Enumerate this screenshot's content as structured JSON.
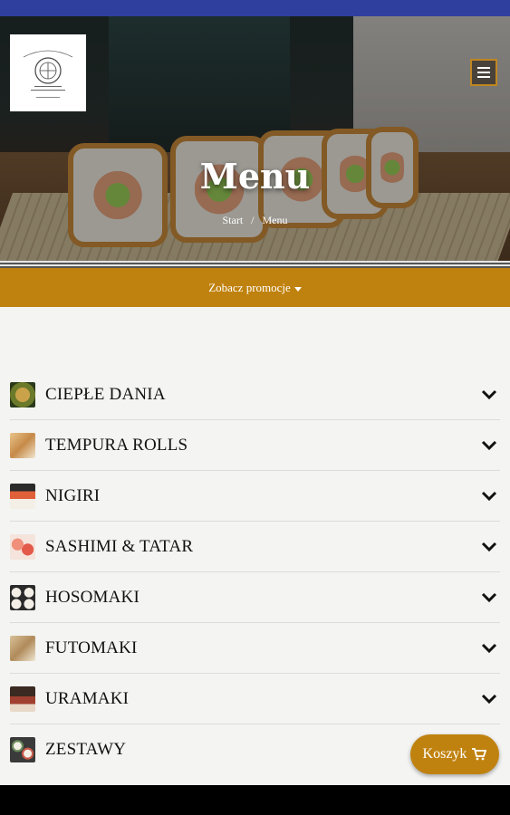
{
  "logo": {
    "alt": "HOTEL GORCZYCE restaurant logo"
  },
  "header": {
    "title": "Menu",
    "breadcrumb": {
      "home": "Start",
      "separator": "/",
      "current": "Menu"
    }
  },
  "promo": {
    "label": "Zobacz promocje"
  },
  "categories": [
    {
      "label": "CIEPŁE DANIA",
      "icon": "warm-dishes-thumb",
      "color": "#6b7a2a"
    },
    {
      "label": "TEMPURA ROLLS",
      "icon": "tempura-thumb",
      "color": "#c68a48"
    },
    {
      "label": "NIGIRI",
      "icon": "nigiri-thumb",
      "color": "#d04a2a"
    },
    {
      "label": "SASHIMI & TATAR",
      "icon": "sashimi-thumb",
      "color": "#e07a6a"
    },
    {
      "label": "HOSOMAKI",
      "icon": "hosomaki-thumb",
      "color": "#3c3c3c"
    },
    {
      "label": "FUTOMAKI",
      "icon": "futomaki-thumb",
      "color": "#b08a5a"
    },
    {
      "label": "URAMAKI",
      "icon": "uramaki-thumb",
      "color": "#a04030"
    },
    {
      "label": "ZESTAWY",
      "icon": "sets-thumb",
      "color": "#6a8a5a"
    }
  ],
  "cart": {
    "label": "Koszyk"
  },
  "colors": {
    "accent": "#c0820f",
    "status_bar": "#2f3f9e"
  }
}
